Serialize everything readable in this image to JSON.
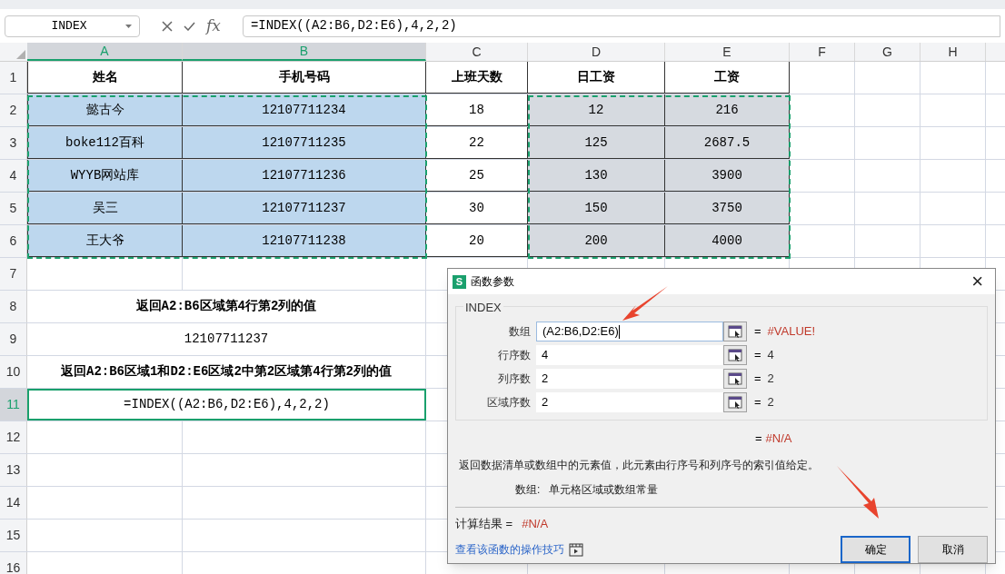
{
  "name_box": {
    "value": "INDEX"
  },
  "formula_bar": {
    "fx": "fx",
    "value": "=INDEX((A2:B6,D2:E6),4,2,2)"
  },
  "columns": [
    {
      "label": "A",
      "selected": true
    },
    {
      "label": "B",
      "selected": true
    },
    {
      "label": "C",
      "selected": false
    },
    {
      "label": "D",
      "selected": false
    },
    {
      "label": "E",
      "selected": false
    },
    {
      "label": "F",
      "selected": false
    },
    {
      "label": "G",
      "selected": false
    },
    {
      "label": "H",
      "selected": false
    }
  ],
  "rows": [
    {
      "number": "1",
      "selected": false,
      "cells": [
        {
          "text": "姓名",
          "bold": true,
          "selected": false,
          "referenced": false
        },
        {
          "text": "手机号码",
          "bold": true,
          "selected": false,
          "referenced": false
        },
        {
          "text": "上班天数",
          "bold": true,
          "selected": false,
          "referenced": false
        },
        {
          "text": "日工资",
          "bold": true,
          "selected": false,
          "referenced": false
        },
        {
          "text": "工资",
          "bold": true,
          "selected": false,
          "referenced": false
        }
      ]
    },
    {
      "number": "2",
      "selected": false,
      "cells": [
        {
          "text": "懿古今",
          "bold": false,
          "selected": true,
          "referenced": false
        },
        {
          "text": "12107711234",
          "bold": false,
          "selected": true,
          "referenced": false
        },
        {
          "text": "18",
          "bold": false,
          "selected": false,
          "referenced": false
        },
        {
          "text": "12",
          "bold": false,
          "selected": false,
          "referenced": true
        },
        {
          "text": "216",
          "bold": false,
          "selected": false,
          "referenced": true
        }
      ]
    },
    {
      "number": "3",
      "selected": false,
      "cells": [
        {
          "text": "boke112百科",
          "bold": false,
          "selected": true,
          "referenced": false
        },
        {
          "text": "12107711235",
          "bold": false,
          "selected": true,
          "referenced": false
        },
        {
          "text": "22",
          "bold": false,
          "selected": false,
          "referenced": false
        },
        {
          "text": "125",
          "bold": false,
          "selected": false,
          "referenced": true
        },
        {
          "text": "2687.5",
          "bold": false,
          "selected": false,
          "referenced": true
        }
      ]
    },
    {
      "number": "4",
      "selected": false,
      "cells": [
        {
          "text": "WYYB网站库",
          "bold": false,
          "selected": true,
          "referenced": false
        },
        {
          "text": "12107711236",
          "bold": false,
          "selected": true,
          "referenced": false
        },
        {
          "text": "25",
          "bold": false,
          "selected": false,
          "referenced": false
        },
        {
          "text": "130",
          "bold": false,
          "selected": false,
          "referenced": true
        },
        {
          "text": "3900",
          "bold": false,
          "selected": false,
          "referenced": true
        }
      ]
    },
    {
      "number": "5",
      "selected": false,
      "cells": [
        {
          "text": "吴三",
          "bold": false,
          "selected": true,
          "referenced": false
        },
        {
          "text": "12107711237",
          "bold": false,
          "selected": true,
          "referenced": false
        },
        {
          "text": "30",
          "bold": false,
          "selected": false,
          "referenced": false
        },
        {
          "text": "150",
          "bold": false,
          "selected": false,
          "referenced": true
        },
        {
          "text": "3750",
          "bold": false,
          "selected": false,
          "referenced": true
        }
      ]
    },
    {
      "number": "6",
      "selected": false,
      "cells": [
        {
          "text": "王大爷",
          "bold": false,
          "selected": true,
          "referenced": false
        },
        {
          "text": "12107711238",
          "bold": false,
          "selected": true,
          "referenced": false
        },
        {
          "text": "20",
          "bold": false,
          "selected": false,
          "referenced": false
        },
        {
          "text": "200",
          "bold": false,
          "selected": false,
          "referenced": true
        },
        {
          "text": "4000",
          "bold": false,
          "selected": false,
          "referenced": true
        }
      ]
    },
    {
      "number": "7",
      "selected": false
    },
    {
      "number": "8",
      "selected": false,
      "merged": {
        "text": "返回A2:B6区域第4行第2列的值",
        "bold": true
      }
    },
    {
      "number": "9",
      "selected": false,
      "merged": {
        "text": "12107711237",
        "bold": false
      }
    },
    {
      "number": "10",
      "selected": false,
      "merged": {
        "text": "返回A2:B6区域1和D2:E6区域2中第2区域第4行第2列的值",
        "bold": true
      }
    },
    {
      "number": "11",
      "selected": true,
      "merged": {
        "text": "=INDEX((A2:B6,D2:E6),4,2,2)",
        "bold": false
      }
    },
    {
      "number": "12",
      "selected": false
    },
    {
      "number": "13",
      "selected": false
    },
    {
      "number": "14",
      "selected": false
    },
    {
      "number": "15",
      "selected": false
    },
    {
      "number": "16",
      "selected": false
    }
  ],
  "dialog": {
    "app_icon": "S",
    "title": "函数参数",
    "close": "×",
    "group": "INDEX",
    "arguments": [
      {
        "label": "数组",
        "value": "(A2:B6,D2:E6)",
        "focused": true,
        "equals": "=",
        "result": "#VALUE!",
        "error": true
      },
      {
        "label": "行序数",
        "value": "4",
        "focused": false,
        "equals": "=",
        "result": "4",
        "error": false
      },
      {
        "label": "列序数",
        "value": "2",
        "focused": false,
        "equals": "=",
        "result": "2",
        "error": false
      },
      {
        "label": "区域序数",
        "value": "2",
        "focused": false,
        "equals": "=",
        "result": "2",
        "error": false
      }
    ],
    "overall": {
      "equals": "=",
      "result": "#N/A"
    },
    "description": "返回数据清单或数组中的元素值，此元素由行序号和列序号的索引值给定。",
    "help": {
      "label": "数组:",
      "text": "单元格区域或数组常量"
    },
    "calc_result": {
      "label": "计算结果 =",
      "value": "#N/A"
    },
    "link": "查看该函数的操作技巧",
    "buttons": [
      {
        "label": "确定",
        "default": true
      },
      {
        "label": "取消",
        "default": false
      }
    ]
  }
}
